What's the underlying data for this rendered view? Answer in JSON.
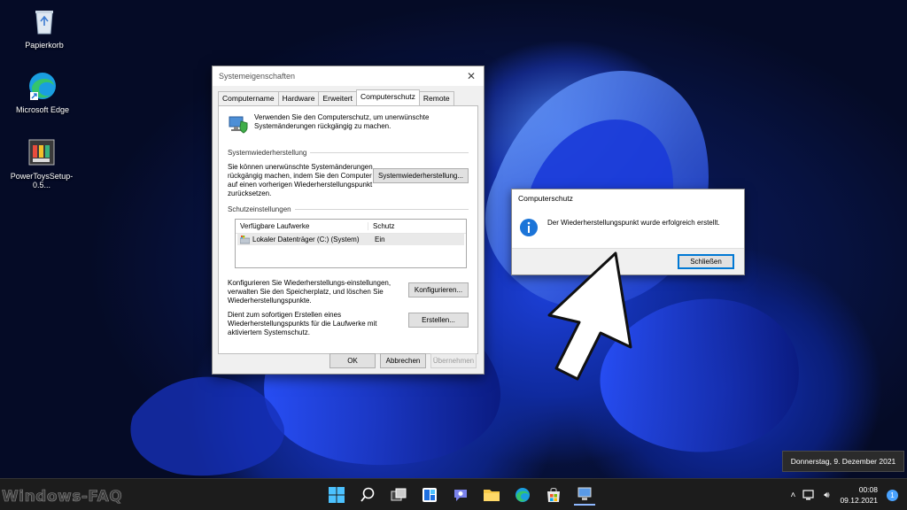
{
  "desktop": {
    "icons": [
      {
        "label": "Papierkorb",
        "icon": "recycle-bin-icon"
      },
      {
        "label": "Microsoft Edge",
        "icon": "edge-icon"
      },
      {
        "label": "PowerToysSetup-0.5...",
        "icon": "installer-icon"
      }
    ]
  },
  "sysprops": {
    "title": "Systemeigenschaften",
    "tabs": [
      "Computername",
      "Hardware",
      "Erweitert",
      "Computerschutz",
      "Remote"
    ],
    "active_tab": "Computerschutz",
    "intro": "Verwenden Sie den Computerschutz, um unerwünschte Systemänderungen rückgängig zu machen.",
    "restore_group": "Systemwiederherstellung",
    "restore_text": "Sie können unerwünschte Systemänderungen rückgängig machen, indem Sie den Computer auf einen vorherigen Wiederherstellungspunkt zurücksetzen.",
    "restore_button": "Systemwiederherstellung...",
    "settings_group": "Schutzeinstellungen",
    "list_headers": [
      "Verfügbare Laufwerke",
      "Schutz"
    ],
    "drives": [
      {
        "name": "Lokaler Datenträger (C:) (System)",
        "protection": "Ein"
      }
    ],
    "configure_text": "Konfigurieren Sie Wiederherstellungs-einstellungen, verwalten Sie den Speicherplatz, und löschen Sie Wiederherstellungspunkte.",
    "configure_button": "Konfigurieren...",
    "create_text": "Dient zum sofortigen Erstellen eines Wiederherstellungspunkts für die Laufwerke mit aktiviertem Systemschutz.",
    "create_button": "Erstellen...",
    "ok": "OK",
    "cancel": "Abbrechen",
    "apply": "Übernehmen"
  },
  "msgbox": {
    "title": "Computerschutz",
    "message": "Der Wiederherstellungspunkt wurde erfolgreich erstellt.",
    "close_button": "Schließen"
  },
  "datetip": "Donnerstag, 9. Dezember 2021",
  "taskbar": {
    "watermark": "Windows-FAQ",
    "time": "00:08",
    "date": "09.12.2021",
    "notification_count": "1"
  }
}
